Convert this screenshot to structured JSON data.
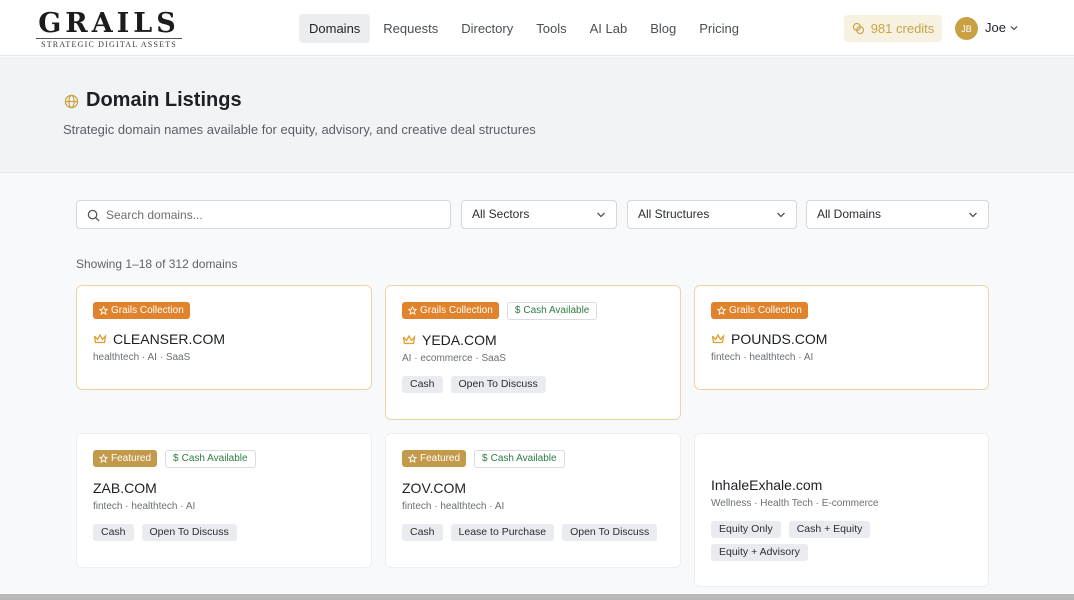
{
  "brand": {
    "name": "GRAILS",
    "tagline": "STRATEGIC DIGITAL ASSETS"
  },
  "nav": [
    {
      "label": "Domains",
      "active": true
    },
    {
      "label": "Requests"
    },
    {
      "label": "Directory"
    },
    {
      "label": "Tools"
    },
    {
      "label": "AI Lab"
    },
    {
      "label": "Blog"
    },
    {
      "label": "Pricing"
    }
  ],
  "credits": {
    "label": "981 credits"
  },
  "user": {
    "initials": "JB",
    "name": "Joe"
  },
  "hero": {
    "title": "Domain Listings",
    "subtitle": "Strategic domain names available for equity, advisory, and creative deal structures"
  },
  "filters": {
    "search_placeholder": "Search domains...",
    "sector": "All Sectors",
    "structure": "All Structures",
    "domains": "All Domains"
  },
  "results": {
    "showing": "Showing 1–18 of 312 domains"
  },
  "listings": [
    {
      "badges": [
        "Grails Collection"
      ],
      "domain": "CLEANSER.COM",
      "crown": true,
      "tags": "healthtech · AI · SaaS",
      "deals": []
    },
    {
      "badges": [
        "Grails Collection",
        "Cash Available"
      ],
      "domain": "YEDA.COM",
      "crown": true,
      "tags": "AI · ecommerce · SaaS",
      "deals": [
        "Cash",
        "Open To Discuss"
      ]
    },
    {
      "badges": [
        "Grails Collection"
      ],
      "domain": "POUNDS.COM",
      "crown": true,
      "tags": "fintech · healthtech · AI",
      "deals": []
    },
    {
      "badges": [
        "Featured",
        "Cash Available"
      ],
      "domain": "ZAB.COM",
      "crown": false,
      "tags": "fintech · healthtech · AI",
      "deals": [
        "Cash",
        "Open To Discuss"
      ]
    },
    {
      "badges": [
        "Featured",
        "Cash Available"
      ],
      "domain": "ZOV.COM",
      "crown": false,
      "tags": "fintech · healthtech · AI",
      "deals": [
        "Cash",
        "Lease to Purchase",
        "Open To Discuss"
      ]
    },
    {
      "badges": [],
      "domain": "InhaleExhale.com",
      "crown": false,
      "tags": "Wellness · Health Tech · E-commerce",
      "deals": [
        "Equity Only",
        "Cash + Equity",
        "Equity + Advisory"
      ]
    }
  ],
  "colors": {
    "accent": "#c9a042",
    "grails_badge": "#e0832c",
    "featured_badge": "#c39a4a",
    "cash_text": "#2e7d43"
  }
}
